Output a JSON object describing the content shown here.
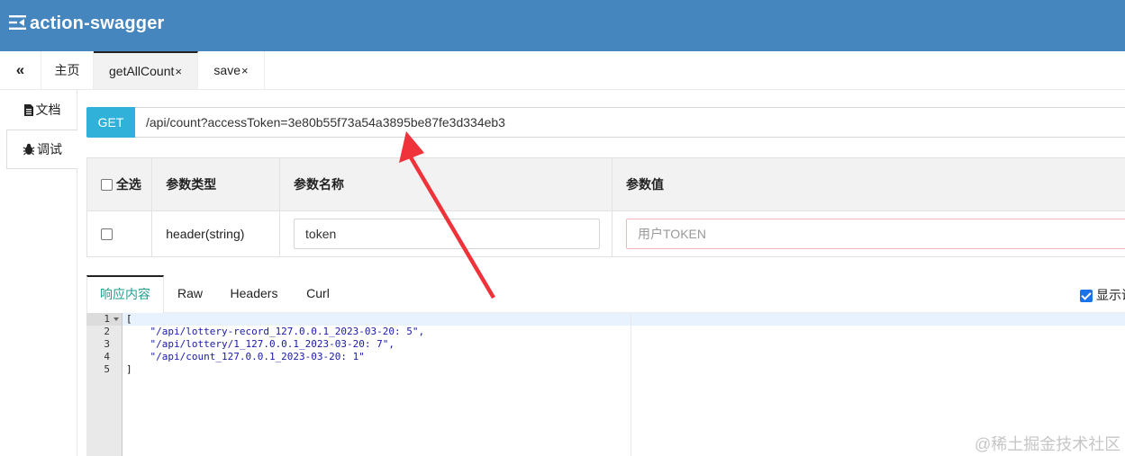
{
  "app": {
    "title": "action-swagger",
    "accent": "#4486bd",
    "menu_icon": "menu-fold-icon"
  },
  "tabs": {
    "collapse_icon": "double-chevron-left-icon",
    "items": [
      {
        "label": "主页",
        "closable": false,
        "active": false
      },
      {
        "label": "getAllCount",
        "closable": true,
        "active": true
      },
      {
        "label": "save",
        "closable": true,
        "active": false
      }
    ],
    "close_glyph": "×"
  },
  "sidebar": {
    "items": [
      {
        "label": "文档",
        "icon": "document-icon",
        "active": false
      },
      {
        "label": "调试",
        "icon": "bug-icon",
        "active": true
      }
    ]
  },
  "request": {
    "method": "GET",
    "method_color": "#2fb1d9",
    "url": "/api/count?accessToken=3e80b55f73a54a3895be87fe3d334eb3"
  },
  "params_table": {
    "select_all": "全选",
    "headers": [
      "参数类型",
      "参数名称",
      "参数值"
    ],
    "rows": [
      {
        "checked": false,
        "type": "header(string)",
        "name": "token",
        "value": "",
        "value_placeholder": "用户TOKEN"
      }
    ]
  },
  "response": {
    "tabs": [
      "响应内容",
      "Raw",
      "Headers",
      "Curl"
    ],
    "active_tab": "响应内容",
    "show_label": "显示说",
    "show_checked": true,
    "line_numbers": [
      "1",
      "2",
      "3",
      "4",
      "5"
    ],
    "lines": [
      "[",
      "    \"/api/lottery-record_127.0.0.1_2023-03-20: 5\",",
      "    \"/api/lottery/1_127.0.0.1_2023-03-20: 7\",",
      "    \"/api/count_127.0.0.1_2023-03-20: 1\"",
      "]"
    ]
  },
  "annotation": {
    "arrow_color": "#f0333a"
  },
  "watermark": "@稀土掘金技术社区"
}
